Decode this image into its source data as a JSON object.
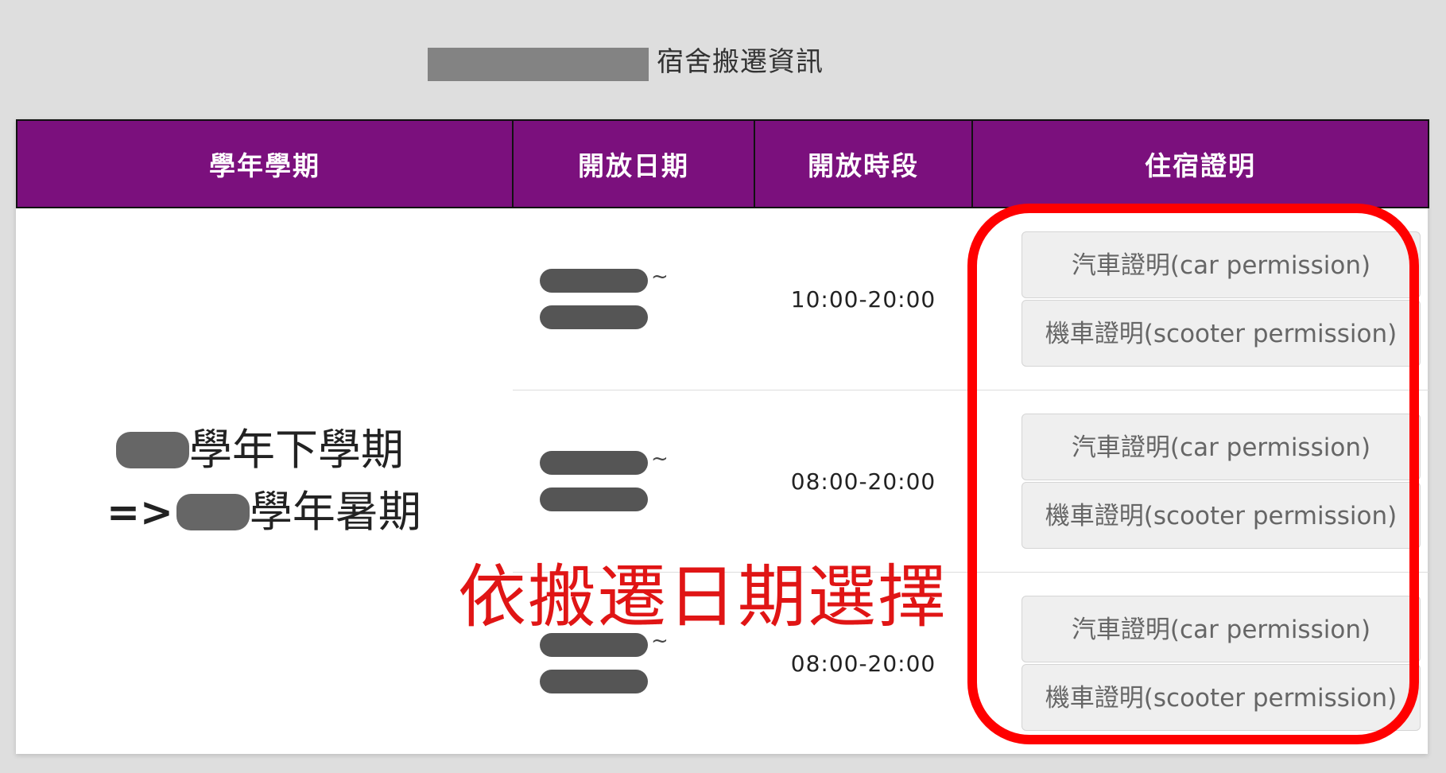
{
  "page": {
    "title": "宿舍搬遷資訊"
  },
  "table": {
    "headers": [
      "學年學期",
      "開放日期",
      "開放時段",
      "住宿證明"
    ],
    "term": {
      "line1_suffix": "學年下學期",
      "line2_prefix": "=>",
      "line2_suffix": "學年暑期"
    },
    "rows": [
      {
        "tilde": "~",
        "time": "10:00-20:00",
        "car_label": "汽車證明(car permission)",
        "scooter_label": "機車證明(scooter permission)"
      },
      {
        "tilde": "~",
        "time": "08:00-20:00",
        "car_label": "汽車證明(car permission)",
        "scooter_label": "機車證明(scooter permission)"
      },
      {
        "tilde": "~",
        "time": "08:00-20:00",
        "car_label": "汽車證明(car permission)",
        "scooter_label": "機車證明(scooter permission)"
      }
    ]
  },
  "annotation": {
    "text": "依搬遷日期選擇",
    "color": "#e01515"
  },
  "colors": {
    "header_bg": "#7b107d",
    "highlight": "#ff0000"
  }
}
